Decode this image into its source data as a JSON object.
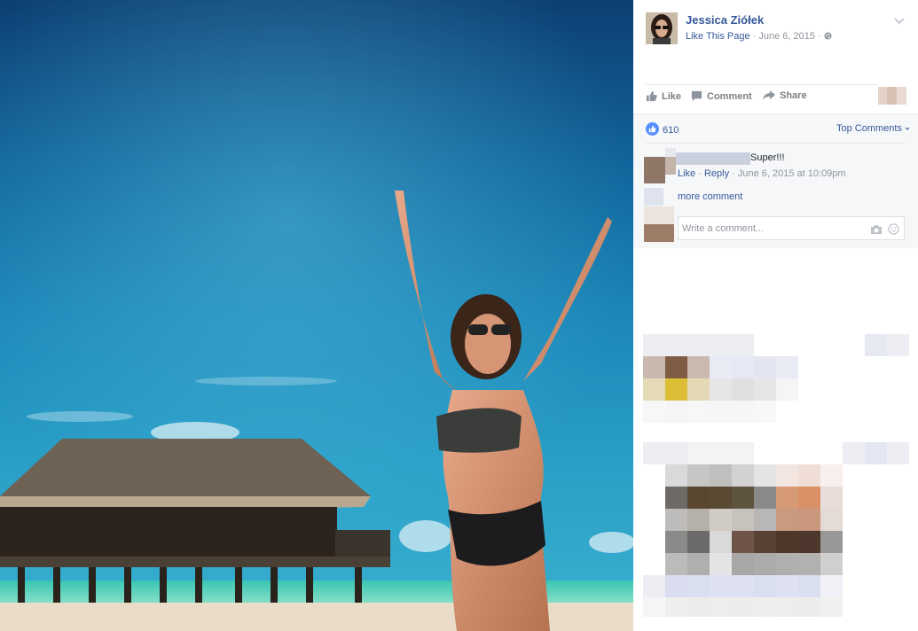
{
  "post": {
    "page_name": "Jessica Ziółek",
    "like_page": "Like This Page",
    "sep1": " · ",
    "date": "June 6, 2015",
    "sep2": " · "
  },
  "actions": {
    "like": "Like",
    "comment": "Comment",
    "share": "Share"
  },
  "reactions": {
    "count": "610",
    "top_comments": "Top Comments"
  },
  "comment": {
    "text": "Super!!!",
    "like": "Like",
    "dot1": " · ",
    "reply": "Reply",
    "dot2": " · ",
    "time": "June 6, 2015 at 10:09pm"
  },
  "more_comments": "more comment",
  "write_comment": {
    "placeholder": "Write a comment..."
  },
  "icons": [
    "page-avatar",
    "chevron-down-icon",
    "globe-icon",
    "like-thumb-icon",
    "comment-icon",
    "share-icon",
    "like-reaction-icon",
    "caret-down-icon",
    "camera-icon",
    "emoji-icon"
  ],
  "colors": {
    "link": "#365899",
    "meta": "#90949c",
    "comments_bg": "#f6f7f9",
    "like_badge": "#5890ff"
  }
}
